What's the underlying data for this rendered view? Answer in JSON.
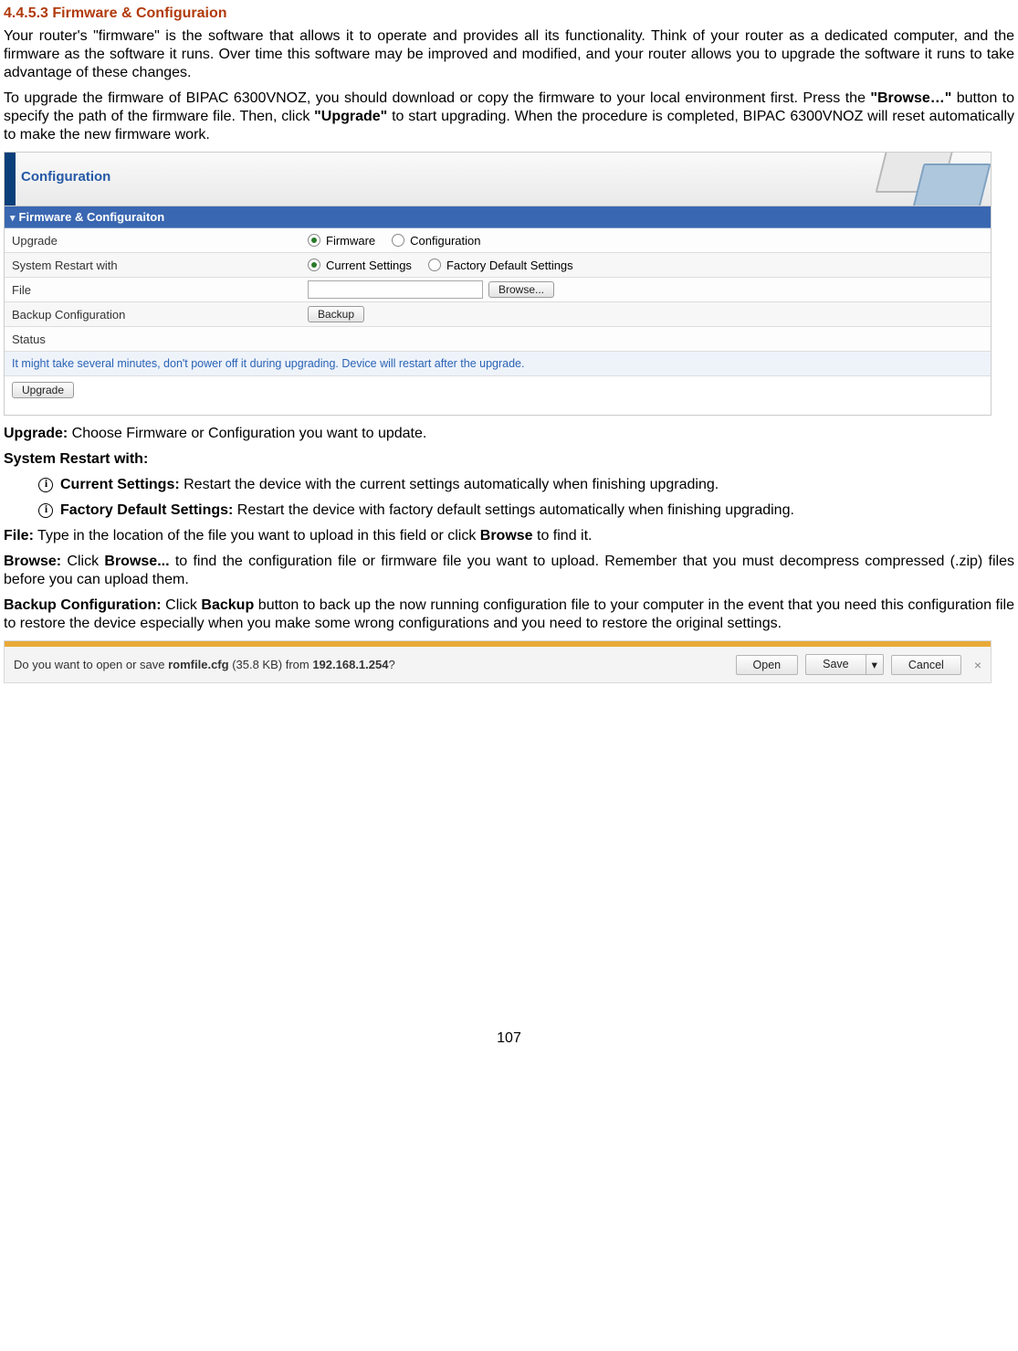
{
  "heading": "4.4.5.3 Firmware & Configuraion",
  "para1": "Your router's \"firmware\" is the software that allows it to operate and provides all its functionality. Think of your router as a dedicated computer, and the firmware as the software it runs. Over time this software may be improved and modified, and your router allows you to upgrade the software it runs to take advantage of these changes.",
  "para2_a": "To upgrade the firmware of BIPAC 6300VNOZ, you should download or copy the firmware to your local environment first. Press the ",
  "para2_b": "\"Browse…\"",
  "para2_c": " button to specify the path of the firmware file. Then, click ",
  "para2_d": "\"Upgrade\"",
  "para2_e": " to start upgrading. When the procedure is completed, BIPAC 6300VNOZ will reset automatically to make the new firmware work.",
  "config": {
    "header_title": "Configuration",
    "sub_title": "Firmware & Configuraiton",
    "rows": {
      "upgrade": {
        "label": "Upgrade",
        "opt1": "Firmware",
        "opt2": "Configuration"
      },
      "restart": {
        "label": "System Restart with",
        "opt1": "Current Settings",
        "opt2": "Factory Default Settings"
      },
      "file": {
        "label": "File",
        "browse_btn": "Browse..."
      },
      "backup": {
        "label": "Backup Configuration",
        "backup_btn": "Backup"
      },
      "status": {
        "label": "Status"
      }
    },
    "note": "It might take several minutes, don't power off it during upgrading. Device will restart after the upgrade.",
    "upgrade_btn": "Upgrade"
  },
  "defs": {
    "upgrade_lbl": "Upgrade:",
    "upgrade_txt": " Choose Firmware or Configuration you want to update.",
    "restart_lbl": "System Restart with:",
    "li1_lbl": "Current Settings:",
    "li1_txt": " Restart the device with the current settings automatically when finishing upgrading.",
    "li2_lbl": "Factory Default Settings:",
    "li2_txt": " Restart the device with factory default settings automatically when finishing upgrading.",
    "file_lbl": "File:",
    "file_txt_a": " Type in the location of the file you want to upload in this field or click ",
    "file_txt_b": "Browse",
    "file_txt_c": " to find it.",
    "browse_lbl": "Browse:",
    "browse_txt_a": " Click ",
    "browse_txt_b": "Browse...",
    "browse_txt_c": " to find the configuration file or firmware file you want to upload. Remember that you must decompress compressed (.zip) files before you can upload them.",
    "backup_lbl": "Backup Configuration:",
    "backup_txt_a": " Click ",
    "backup_txt_b": "Backup",
    "backup_txt_c": " button to back up the now running configuration file to your computer in the event that you need this configuration file to restore the device especially when you make some wrong configurations and you need to restore the original settings."
  },
  "dl": {
    "msg_a": "Do you want to open or save ",
    "msg_b": "romfile.cfg",
    "msg_c": " (35.8 KB) from ",
    "msg_d": "192.168.1.254",
    "msg_e": "?",
    "open": "Open",
    "save": "Save",
    "arrow": "▾",
    "cancel": "Cancel",
    "close": "×"
  },
  "page_number": "107"
}
